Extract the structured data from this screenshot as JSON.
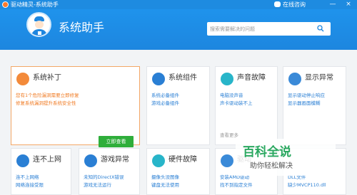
{
  "titlebar": {
    "title": "驱动精灵-系统助手",
    "consult": "在线咨询",
    "minimize": "—",
    "close": "×"
  },
  "header": {
    "app_title": "系统助手",
    "search_placeholder": "搜索需要解决的问题"
  },
  "cards": {
    "patch": {
      "title": "系统补丁",
      "line1": "您有1个危险漏洞需要立即修复",
      "line2": "修复系统漏洞提升系统安全性",
      "button": "立即查看"
    },
    "component": {
      "title": "系统组件",
      "line1": "系统必备组件",
      "line2": "游戏必备组件"
    },
    "sound": {
      "title": "声音故障",
      "line1": "电脑没声音",
      "line2": "声卡驱动装不上",
      "more": "查看更多"
    },
    "display": {
      "title": "显示异常",
      "line1": "显示驱动停止响应",
      "line2": "显示器画面模糊"
    },
    "network": {
      "title": "连不上网",
      "line1": "连不上网络",
      "line2": "网络连接受限"
    },
    "game": {
      "title": "游戏异常",
      "line1": "未知的DirectX错误",
      "line2": "游戏无法运行"
    },
    "hardware": {
      "title": "硬件故障",
      "line1": "摄像头没图像",
      "line2": "键盘无法使用"
    },
    "driver": {
      "title": "驱动",
      "line1": "安装AMD驱动",
      "line2": "找不到指定文件"
    },
    "dll": {
      "line1": "DLL文件",
      "line2": "缺少MVCP110.dll"
    }
  },
  "watermark": {
    "logo": "百科全说",
    "sub": "助你轻松解决"
  },
  "colors": {
    "header_blue": "#1d86df",
    "accent_orange": "#f07a22",
    "link_blue": "#2a7fd4",
    "button_green": "#2fae3b"
  }
}
